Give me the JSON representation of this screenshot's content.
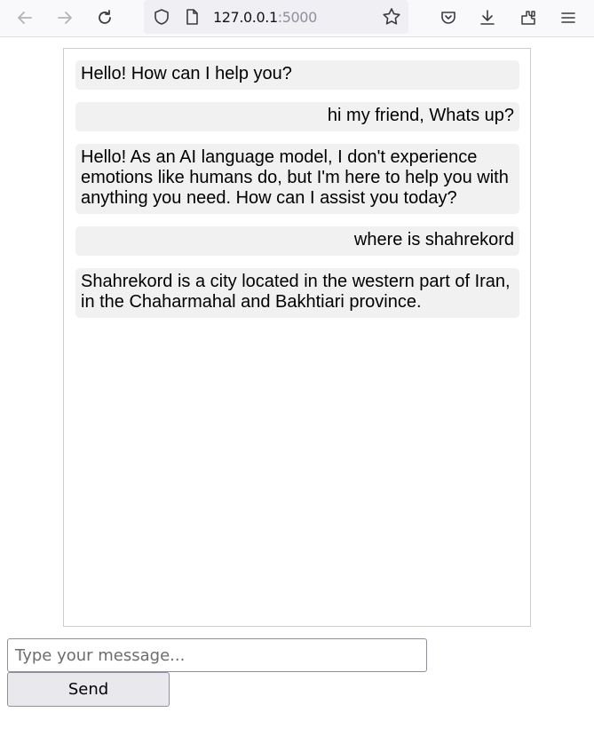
{
  "browser": {
    "url_host": "127.0.0.1",
    "url_port": ":5000",
    "icons": [
      "back-icon",
      "forward-icon",
      "reload-icon",
      "shield-icon",
      "page-icon",
      "bookmark-star-icon",
      "pocket-icon",
      "download-icon",
      "extensions-icon",
      "menu-icon"
    ]
  },
  "chat": {
    "messages": [
      {
        "role": "bot",
        "text": "Hello! How can I help you?"
      },
      {
        "role": "user",
        "text": "hi my friend, Whats up?"
      },
      {
        "role": "bot",
        "text": "Hello! As an AI language model, I don't experience emotions like humans do, but I'm here to help you with anything you need. How can I assist you today?"
      },
      {
        "role": "user",
        "text": "where is shahrekord"
      },
      {
        "role": "bot",
        "text": "Shahrekord is a city located in the western part of Iran, in the Chaharmahal and Bakhtiari province."
      }
    ]
  },
  "composer": {
    "placeholder": "Type your message...",
    "value": "",
    "send_label": "Send"
  },
  "colors": {
    "message_bg": "#f1f1f1",
    "chat_border": "#cccccc",
    "button_bg": "#e9e9ed"
  }
}
